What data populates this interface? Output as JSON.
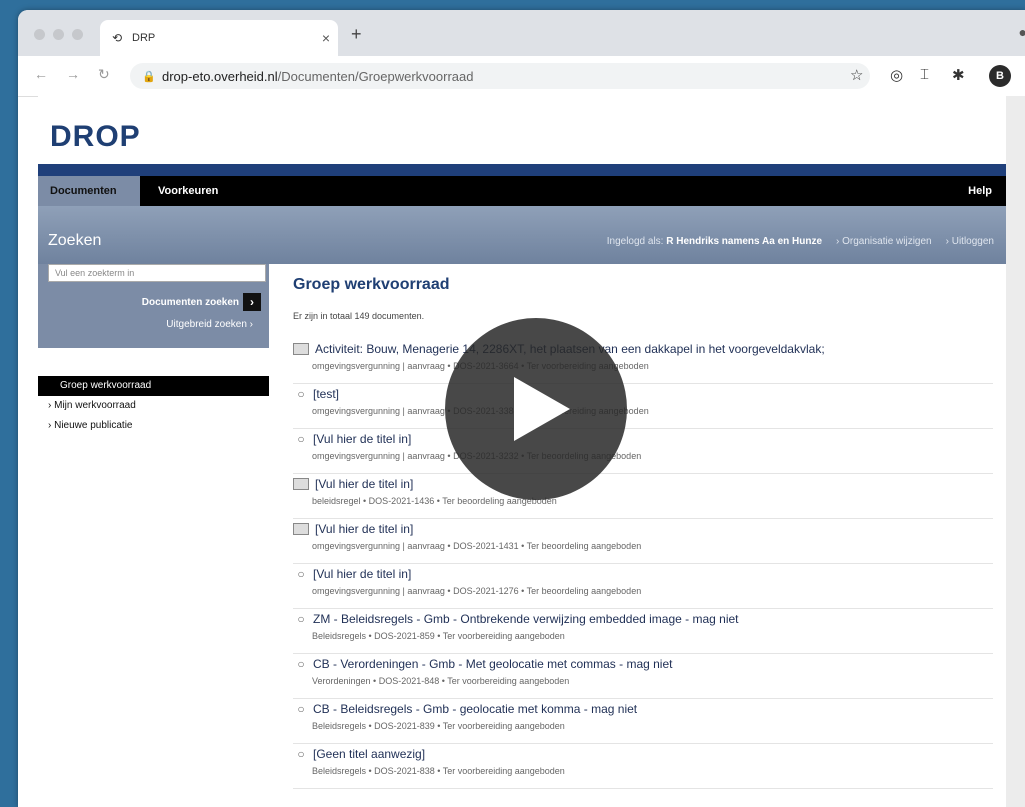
{
  "browser": {
    "tab_title": "DRP",
    "url_host": "drop-eto.overheid.nl",
    "url_path": "/Documenten/Groepwerkvoorraad",
    "avatar_letter": "B"
  },
  "site": {
    "logo": "DROP",
    "menu": {
      "documenten": "Documenten",
      "voorkeuren": "Voorkeuren",
      "help": "Help"
    },
    "zoeken_title": "Zoeken",
    "login_label": "Ingelogd als:",
    "login_user": "R Hendriks namens Aa en Hunze",
    "org_link": "Organisatie wijzigen",
    "logout_link": "Uitloggen",
    "search_placeholder": "Vul een zoekterm in",
    "search_button": "Documenten zoeken",
    "advanced_link": "Uitgebreid zoeken",
    "nav": [
      "Groep werkvoorraad",
      "Mijn werkvoorraad",
      "Nieuwe publicatie"
    ],
    "page_title": "Groep werkvoorraad",
    "count_text": "Er zijn in totaal 149 documenten.",
    "documents": [
      {
        "icon": "doc",
        "title": "Activiteit: Bouw, Menagerie 14, 2286XT, het plaatsen van een dakkapel in het voorgeveldakvlak;",
        "meta": "omgevingsvergunning | aanvraag • DOS-2021-3664 • Ter voorbereiding aangeboden"
      },
      {
        "icon": "circle",
        "title": "[test]",
        "meta": "omgevingsvergunning | aanvraag • DOS-2021-3385 • Ter voorbereiding aangeboden"
      },
      {
        "icon": "circle",
        "title": "[Vul hier de titel in]",
        "meta": "omgevingsvergunning | aanvraag • DOS-2021-3232 • Ter beoordeling aangeboden"
      },
      {
        "icon": "doc",
        "title": "[Vul hier de titel in]",
        "meta": "beleidsregel • DOS-2021-1436 • Ter beoordeling aangeboden"
      },
      {
        "icon": "doc",
        "title": "[Vul hier de titel in]",
        "meta": "omgevingsvergunning | aanvraag • DOS-2021-1431 • Ter beoordeling aangeboden"
      },
      {
        "icon": "circle",
        "title": "[Vul hier de titel in]",
        "meta": "omgevingsvergunning | aanvraag • DOS-2021-1276 • Ter beoordeling aangeboden"
      },
      {
        "icon": "circle",
        "title": "ZM - Beleidsregels - Gmb - Ontbrekende verwijzing embedded image - mag niet",
        "meta": "Beleidsregels • DOS-2021-859 • Ter voorbereiding aangeboden"
      },
      {
        "icon": "circle",
        "title": "CB - Verordeningen - Gmb - Met geolocatie met commas - mag niet",
        "meta": "Verordeningen • DOS-2021-848 • Ter voorbereiding aangeboden"
      },
      {
        "icon": "circle",
        "title": "CB - Beleidsregels - Gmb - geolocatie met komma - mag niet",
        "meta": "Beleidsregels • DOS-2021-839 • Ter voorbereiding aangeboden"
      },
      {
        "icon": "circle",
        "title": "[Geen titel aanwezig]",
        "meta": "Beleidsregels • DOS-2021-838 • Ter voorbereiding aangeboden"
      }
    ]
  }
}
